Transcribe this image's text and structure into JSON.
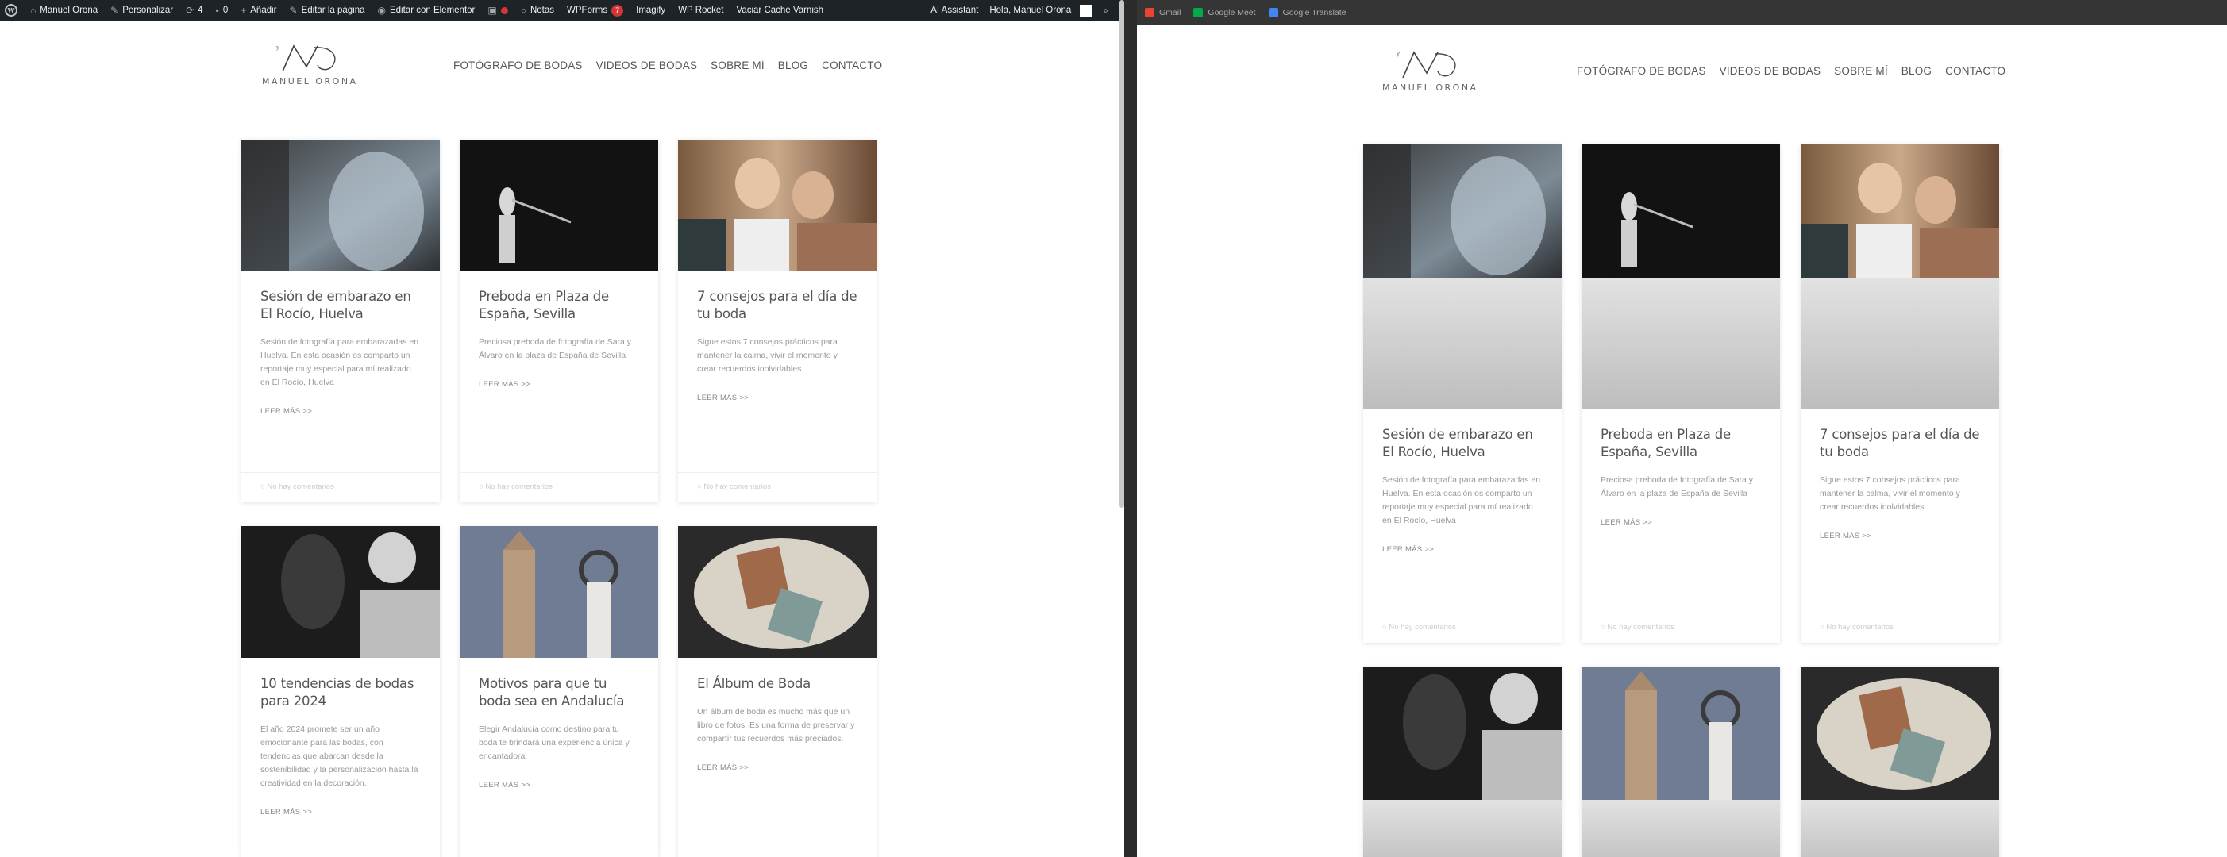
{
  "admin_bar": {
    "items": [
      {
        "icon": "wordpress-logo-icon",
        "label": ""
      },
      {
        "icon": "home-icon",
        "label": "Manuel Orona"
      },
      {
        "icon": "brush-icon",
        "label": "Personalizar"
      },
      {
        "icon": "updates-icon",
        "label": "4"
      },
      {
        "icon": "comments-icon",
        "label": "0"
      },
      {
        "icon": "plus-icon",
        "label": "Añadir"
      },
      {
        "icon": "edit-icon",
        "label": "Editar la página"
      },
      {
        "icon": "elementor-icon",
        "label": "Editar con Elementor"
      }
    ],
    "notes": "Notas",
    "wpforms": "WPForms",
    "wpforms_badge": "7",
    "imagify": "Imagify",
    "wp_rocket": "WP Rocket",
    "varnish": "Vaciar Cache Varnish",
    "ai_assistant": "AI Assistant",
    "greeting": "Hola, Manuel Orona"
  },
  "site": {
    "logo_text": "MANUEL ORONA",
    "nav": [
      "FOTÓGRAFO DE BODAS",
      "VIDEOS DE BODAS",
      "SOBRE MÍ",
      "BLOG",
      "CONTACTO"
    ],
    "read_more": "LEER MÁS >>",
    "comments": "No hay comentarios",
    "posts": [
      {
        "title": "Sesión de embarazo en El Rocío, Huelva",
        "excerpt": "Sesión de fotografía para embarazadas en Huelva. En esta ocasión os comparto un reportaje muy especial para mí realizado en El Rocío, Huelva"
      },
      {
        "title": "Preboda en Plaza de España, Sevilla",
        "excerpt": "Preciosa preboda de fotografía de Sara y Álvaro en la plaza de España de Sevilla"
      },
      {
        "title": "7 consejos para el día de tu boda",
        "excerpt": "Sigue estos 7 consejos prácticos para mantener la calma, vivir el momento y crear recuerdos inolvidables."
      },
      {
        "title": "10 tendencias de bodas para 2024",
        "excerpt": "El año 2024 promete ser un año emocionante para las bodas, con tendencias que abarcan desde la sostenibilidad y la personalización hasta la creatividad en la decoración."
      },
      {
        "title": "Motivos para que tu boda sea en Andalucía",
        "excerpt": "Elegir Andalucía como destino para tu boda te brindará una experiencia única y encantadora."
      },
      {
        "title": "El Álbum de Boda",
        "excerpt": "Un álbum de boda es mucho más que un libro de fotos. Es una forma de preservar y compartir tus recuerdos más preciados."
      }
    ]
  },
  "bookmarks": [
    {
      "label": "Gmail",
      "color": "#ea4335"
    },
    {
      "label": "Google Meet",
      "color": "#00ac47"
    },
    {
      "label": "Google Translate",
      "color": "#4285f4"
    }
  ]
}
